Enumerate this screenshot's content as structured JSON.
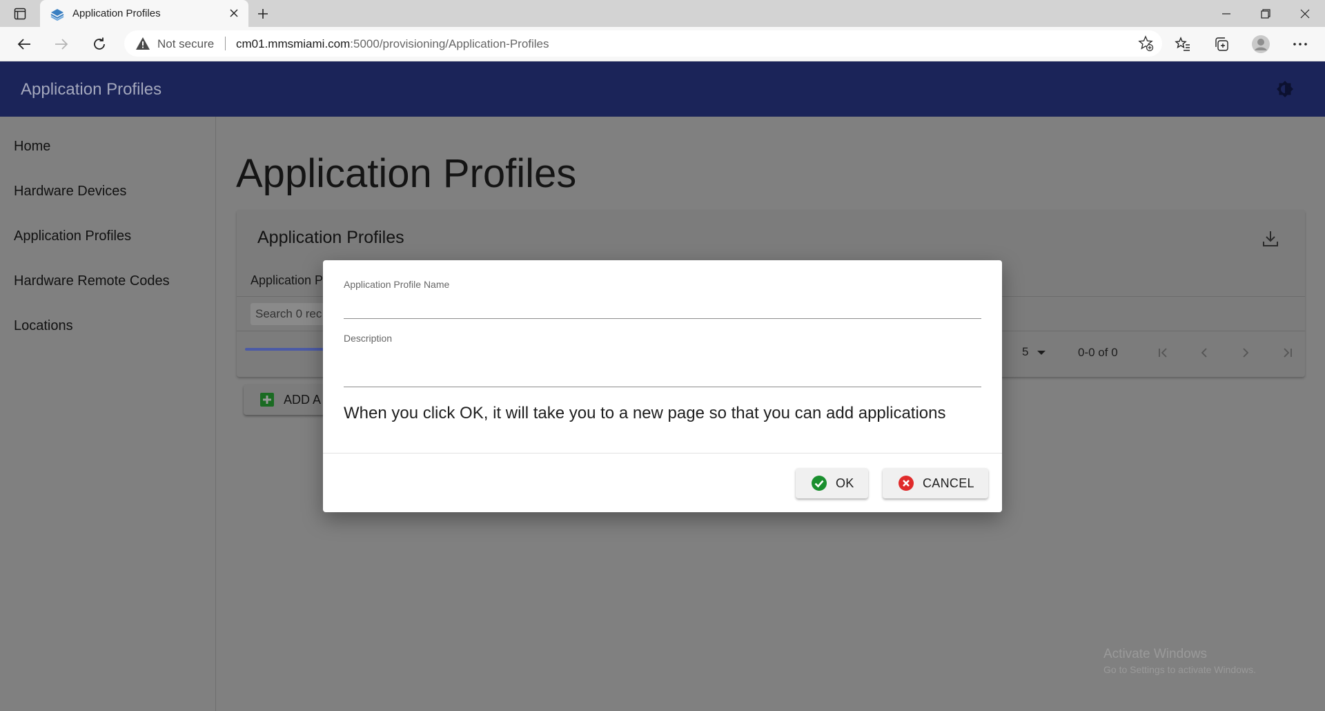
{
  "browser": {
    "tab_title": "Application Profiles",
    "not_secure_label": "Not secure",
    "url_host": "cm01.mmsmiami.com",
    "url_rest": ":5000/provisioning/Application-Profiles"
  },
  "appbar": {
    "title": "Application Profiles",
    "color": "#1b2459"
  },
  "sidebar": {
    "items": [
      {
        "label": "Home"
      },
      {
        "label": "Hardware Devices"
      },
      {
        "label": "Application Profiles"
      },
      {
        "label": "Hardware Remote Codes"
      },
      {
        "label": "Locations"
      }
    ]
  },
  "main": {
    "page_title": "Application Profiles",
    "card": {
      "title": "Application Profiles",
      "column_header": "Application P",
      "search_placeholder": "Search 0 rec",
      "rows_per_page": "5",
      "page_range": "0-0 of 0"
    },
    "add_button_label": "ADD A"
  },
  "dialog": {
    "name_label": "Application Profile Name",
    "name_value": "",
    "description_label": "Description",
    "description_value": "",
    "message": "When you click OK, it will take you to a new page so that you can add applications",
    "ok_label": "OK",
    "cancel_label": "CANCEL",
    "ok_color": "#1a8f2e",
    "cancel_color": "#e02b2b"
  },
  "watermark": {
    "line1": "Activate Windows",
    "line2": "Go to Settings to activate Windows."
  }
}
